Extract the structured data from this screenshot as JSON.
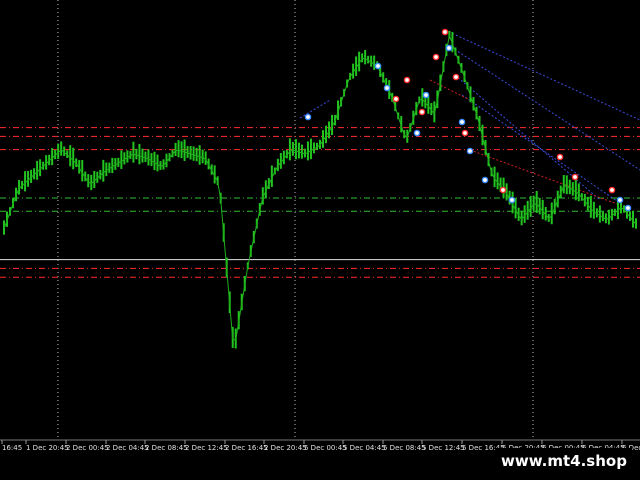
{
  "chart_data": {
    "type": "line",
    "title": "",
    "xlabel": "",
    "ylabel": "",
    "x": [
      "16:45",
      "1 Dec 20:45",
      "2 Dec 00:45",
      "2 Dec 04:45",
      "2 Dec 08:45",
      "2 Dec 12:45",
      "2 Dec 16:45",
      "2 Dec 20:45",
      "5 Dec 00:45",
      "5 Dec 04:45",
      "5 Dec 08:45",
      "5 Dec 12:45",
      "5 Dec 16:45",
      "5 Dec 20:45",
      "6 Dec 00:45",
      "6 Dec 04:45",
      "6 Dec 08:45"
    ],
    "ylim": [
      0,
      100
    ],
    "grid": true,
    "series": [
      {
        "values": [
          48,
          57,
          60,
          63,
          66,
          63,
          58,
          61,
          63,
          65,
          64,
          62,
          66,
          65,
          64,
          58,
          20,
          40,
          55,
          62,
          66,
          65,
          67,
          72,
          82,
          87,
          85,
          78,
          68,
          78,
          74,
          92,
          83,
          73,
          60,
          56,
          50,
          54,
          50,
          58,
          56,
          52,
          50,
          53,
          49
        ],
        "color": "#22c41f"
      }
    ],
    "horizontal_levels": [
      {
        "value": 71,
        "color": "#ff2b2b"
      },
      {
        "value": 69,
        "color": "#ff2b2b"
      },
      {
        "value": 66,
        "color": "#ff2b2b"
      },
      {
        "value": 55,
        "color": "#30c030"
      },
      {
        "value": 52,
        "color": "#30c030"
      },
      {
        "value": 41,
        "color": "#e0e0e0"
      },
      {
        "value": 39,
        "color": "#ff2b2b"
      },
      {
        "value": 37,
        "color": "#ff2b2b"
      }
    ]
  },
  "branding": {
    "watermark": "www.mt4.shop"
  }
}
